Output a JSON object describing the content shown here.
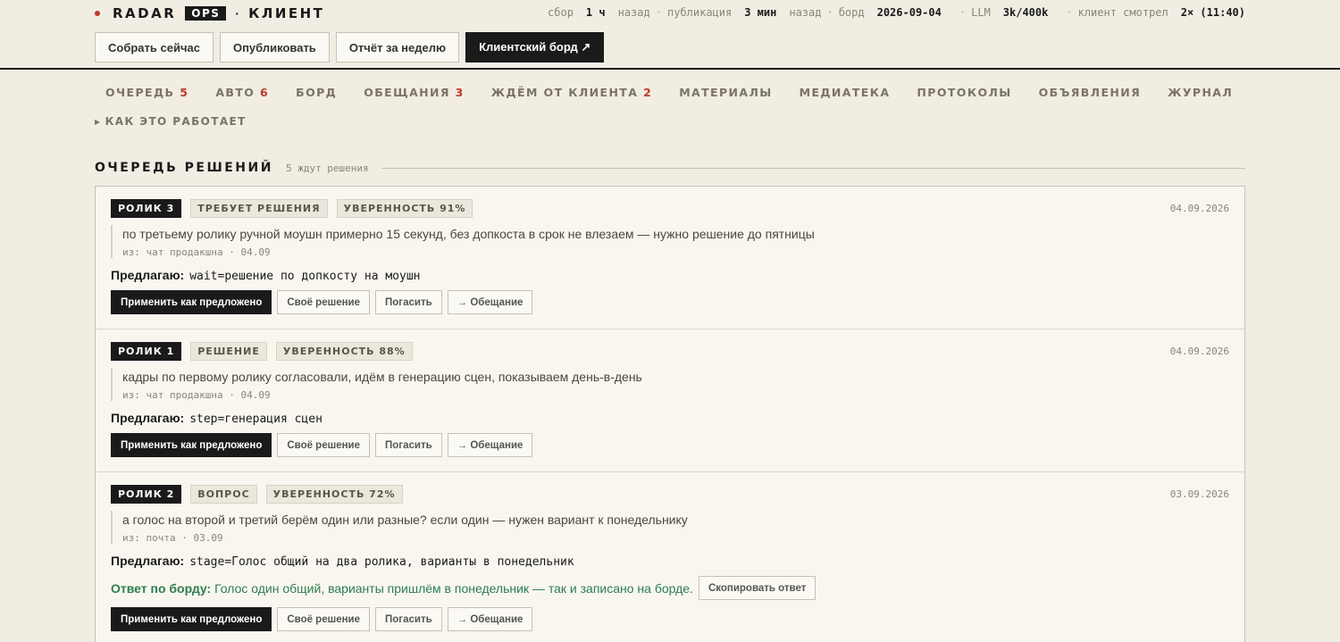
{
  "brand": {
    "name": "RADAR",
    "badge": "OPS",
    "sep": "·",
    "client": "КЛИЕНТ"
  },
  "status": {
    "collect_label": "сбор",
    "collect_value": "1 ч",
    "collect_suffix": "назад",
    "publish_label": "публикация",
    "publish_value": "3 мин",
    "publish_suffix": "назад",
    "board_label": "борд",
    "board_value": "2026-09-04",
    "llm_label": "LLM",
    "llm_value": "3k/400k",
    "client_label": "клиент смотрел",
    "client_value": "2× (11:40)"
  },
  "actions": {
    "collect_now": "Собрать сейчас",
    "publish": "Опубликовать",
    "weekly_report": "Отчёт за неделю",
    "client_board": "Клиентский борд ↗"
  },
  "nav": {
    "queue_label": "ОЧЕРЕДЬ",
    "queue_count": "5",
    "auto_label": "АВТО",
    "auto_count": "6",
    "board_label": "БОРД",
    "promises_label": "ОБЕЩАНИЯ",
    "promises_count": "3",
    "waiting_label": "ЖДЁМ ОТ КЛИЕНТА",
    "waiting_count": "2",
    "materials_label": "МАТЕРИАЛЫ",
    "media_label": "МЕДИАТЕКА",
    "protocols_label": "ПРОТОКОЛЫ",
    "ads_label": "ОБЪЯВЛЕНИЯ",
    "journal_label": "ЖУРНАЛ",
    "howto_label": "КАК ЭТО РАБОТАЕТ"
  },
  "section": {
    "title": "ОЧЕРЕДЬ РЕШЕНИЙ",
    "subtitle": "5 ждут решения"
  },
  "card_buttons": {
    "apply": "Применить как предложено",
    "own": "Своё решение",
    "dismiss": "Погасить",
    "promise": "→ Обещание",
    "copy_answer": "Скопировать ответ"
  },
  "suggest_label": "Предлагаю:",
  "cards": [
    {
      "tag_clip": "РОЛИК 3",
      "tag_type": "ТРЕБУЕТ РЕШЕНИЯ",
      "tag_conf": "УВЕРЕННОСТЬ 91%",
      "date": "04.09.2026",
      "text": "по третьему ролику ручной моушн примерно 15 секунд, без допкоста в срок не влезаем — нужно решение до пятницы",
      "source": "из: чат продакшна · 04.09",
      "suggest": "wait=решение по допкосту на моушн"
    },
    {
      "tag_clip": "РОЛИК 1",
      "tag_type": "РЕШЕНИЕ",
      "tag_conf": "УВЕРЕННОСТЬ 88%",
      "date": "04.09.2026",
      "text": "кадры по первому ролику согласовали, идём в генерацию сцен, показываем день-в-день",
      "source": "из: чат продакшна · 04.09",
      "suggest": "step=генерация сцен"
    },
    {
      "tag_clip": "РОЛИК 2",
      "tag_type": "ВОПРОС",
      "tag_conf": "УВЕРЕННОСТЬ 72%",
      "date": "03.09.2026",
      "text": "а голос на второй и третий берём один или разные? если один — нужен вариант к понедельнику",
      "source": "из: почта · 03.09",
      "suggest": "stage=Голос общий на два ролика, варианты в понедельник",
      "answer_label": "Ответ по борду:",
      "answer_text": "Голос один общий, варианты пришлём в понедельник — так и записано на борде."
    }
  ]
}
